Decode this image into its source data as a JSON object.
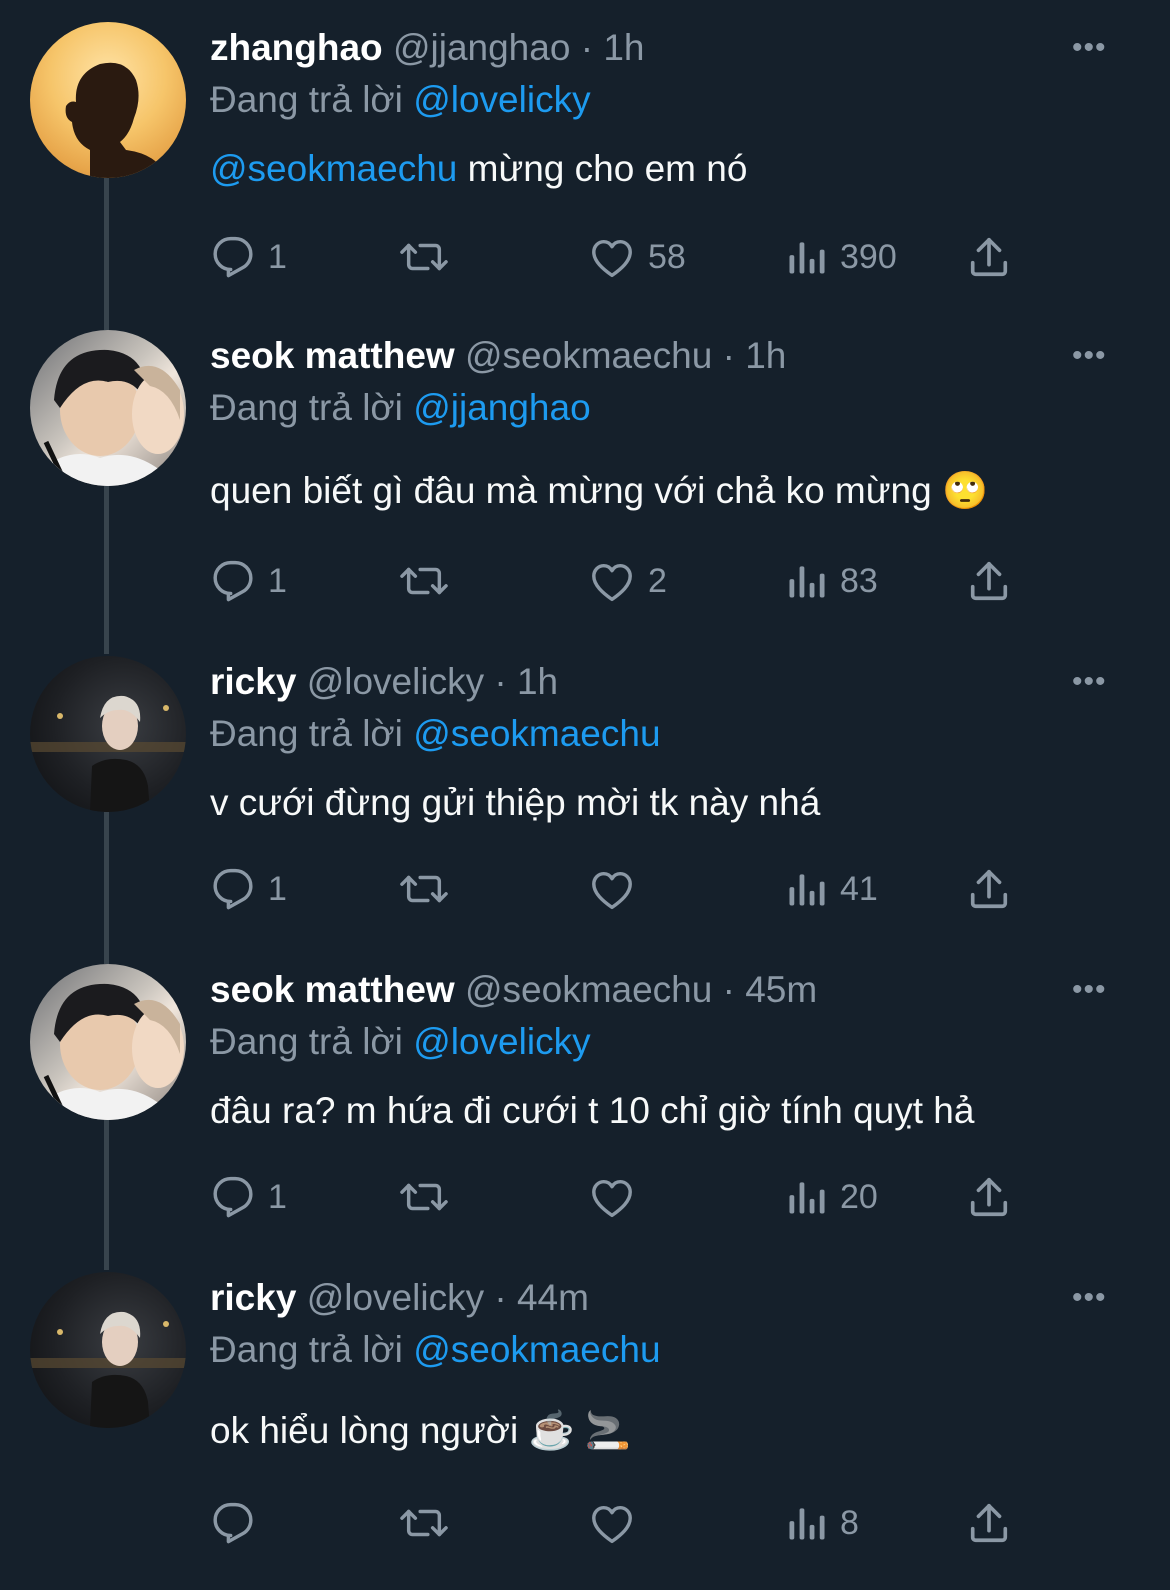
{
  "reply_prefix": "Đang trả lời",
  "tweets": [
    {
      "name": "zhanghao",
      "handle": "@jjanghao",
      "time": "1h",
      "reply_to": "@lovelicky",
      "mention": "@seokmaechu",
      "text": " mừng cho em nó",
      "replies": "1",
      "retweets": "",
      "likes": "58",
      "views": "390"
    },
    {
      "name": "seok matthew",
      "handle": "@seokmaechu",
      "time": "1h",
      "reply_to": "@jjanghao",
      "text": "quen biết gì đâu mà mừng với chả ko mừng 🙄",
      "replies": "1",
      "retweets": "",
      "likes": "2",
      "views": "83"
    },
    {
      "name": "ricky",
      "handle": "@lovelicky",
      "time": "1h",
      "reply_to": "@seokmaechu",
      "text": "v cưới đừng gửi thiệp mời tk này nhá",
      "replies": "1",
      "retweets": "",
      "likes": "",
      "views": "41"
    },
    {
      "name": "seok matthew",
      "handle": "@seokmaechu",
      "time": "45m",
      "reply_to": "@lovelicky",
      "text": "đâu ra? m hứa đi cưới t 10 chỉ giờ tính quỵt hả",
      "replies": "1",
      "retweets": "",
      "likes": "",
      "views": "20"
    },
    {
      "name": "ricky",
      "handle": "@lovelicky",
      "time": "44m",
      "reply_to": "@seokmaechu",
      "text": "ok hiểu lòng người ☕️ 🚬",
      "replies": "",
      "retweets": "",
      "likes": "",
      "views": "8"
    }
  ],
  "colors": {
    "background": "#15202b",
    "link": "#1d9bf0",
    "muted": "#8b98a5"
  },
  "icons": [
    "reply-icon",
    "retweet-icon",
    "like-icon",
    "views-icon",
    "share-icon",
    "more-icon"
  ]
}
